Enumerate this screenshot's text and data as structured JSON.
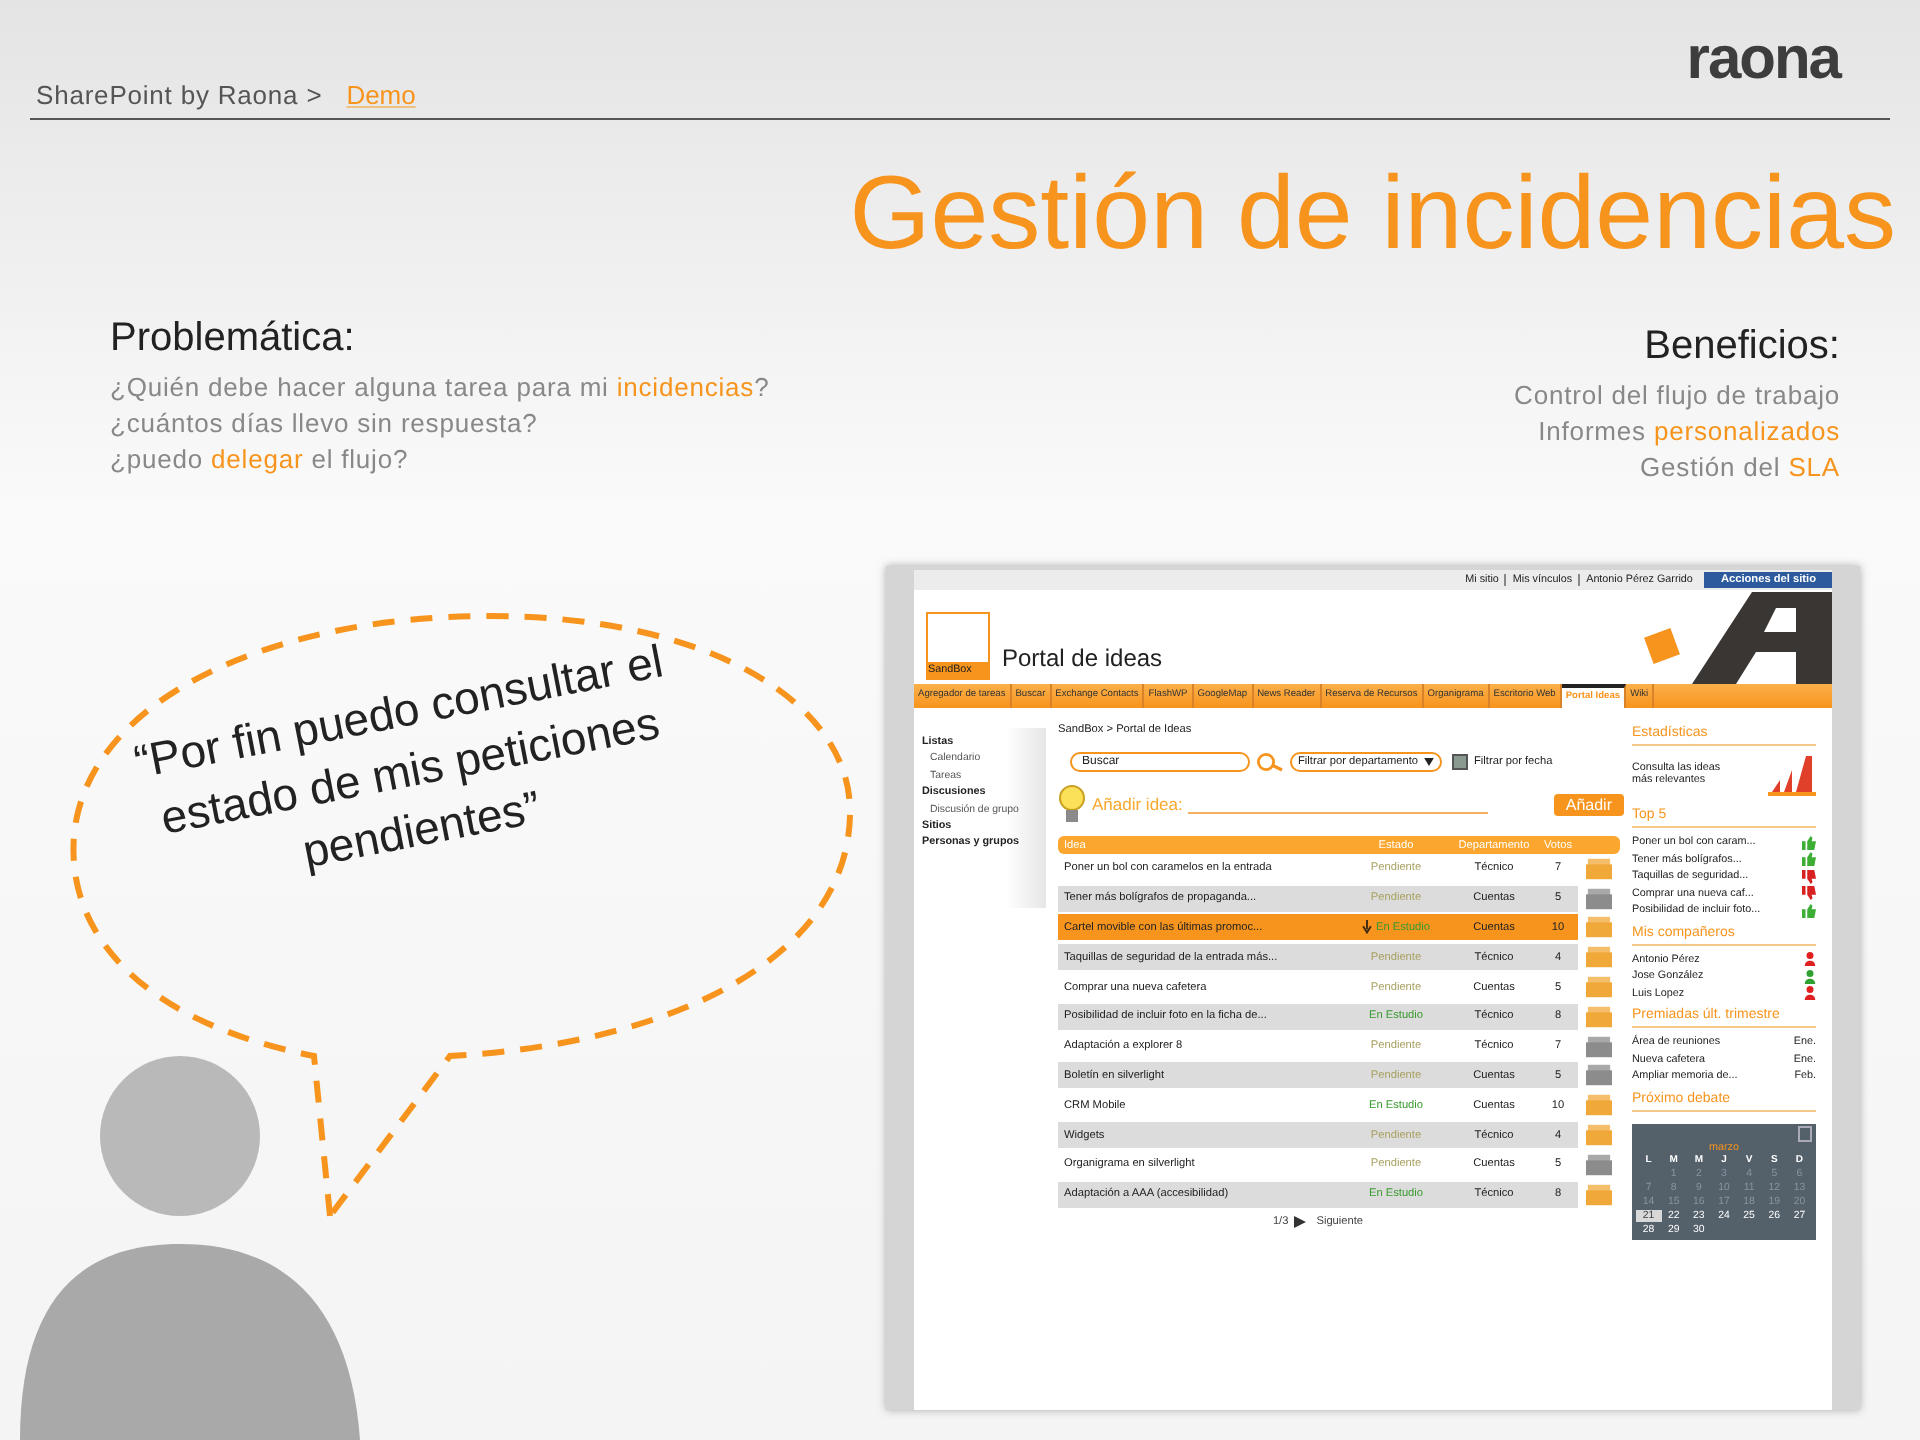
{
  "header": {
    "breadcrumb": "SharePoint by Raona >",
    "current": "Demo",
    "logo": "raona"
  },
  "title": "Gestión de incidencias",
  "problems": {
    "heading": "Problemática:",
    "lines": [
      [
        {
          "text": "¿Quién debe hacer alguna tarea para mi ",
          "highlight": false
        },
        {
          "text": "incidencias",
          "highlight": true
        },
        {
          "text": "?",
          "highlight": false
        }
      ],
      [
        {
          "text": "¿cuántos días llevo sin respuesta?",
          "highlight": false
        }
      ],
      [
        {
          "text": "¿puedo ",
          "highlight": false
        },
        {
          "text": "delegar",
          "highlight": true
        },
        {
          "text": " el flujo?",
          "highlight": false
        }
      ]
    ]
  },
  "benefits": {
    "heading": "Beneficios:",
    "lines": [
      [
        {
          "text": "Control del flujo de trabajo",
          "highlight": false
        }
      ],
      [
        {
          "text": "Informes ",
          "highlight": false
        },
        {
          "text": "personalizados",
          "highlight": true
        }
      ],
      [
        {
          "text": "Gestión del ",
          "highlight": false
        },
        {
          "text": "SLA",
          "highlight": true
        }
      ]
    ]
  },
  "quote": "“Por fin puedo consultar el estado de mis peticiones pendientes”",
  "sharepoint": {
    "top_links": [
      "Mi sitio",
      "Mis vínculos",
      "Antonio Pérez Garrido"
    ],
    "actions": "Acciones del sitio",
    "logo_label": "SandBox",
    "site_title": "Portal de ideas",
    "tabs": [
      {
        "label": "Agregador de tareas",
        "selected": false
      },
      {
        "label": "Buscar",
        "selected": false
      },
      {
        "label": "Exchange Contacts",
        "selected": false
      },
      {
        "label": "FlashWP",
        "selected": false
      },
      {
        "label": "GoogleMap",
        "selected": false
      },
      {
        "label": "News Reader",
        "selected": false
      },
      {
        "label": "Reserva de Recursos",
        "selected": false
      },
      {
        "label": "Organigrama",
        "selected": false
      },
      {
        "label": "Escritorio Web",
        "selected": false
      },
      {
        "label": "Portal Ideas",
        "selected": true
      },
      {
        "label": "Wiki",
        "selected": false
      }
    ],
    "quick_launch": [
      {
        "label": "Listas",
        "children": [
          {
            "label": "Calendario"
          },
          {
            "label": "Tareas"
          }
        ]
      },
      {
        "label": "Discusiones",
        "children": [
          {
            "label": "Discusión de grupo"
          }
        ]
      },
      {
        "label": "Sitios"
      },
      {
        "label": "Personas y grupos"
      }
    ],
    "breadcrumb": "SandBox > Portal de Ideas",
    "search": {
      "placeholder": "Buscar"
    },
    "department_filter": "Filtrar por departamento",
    "date_filter": {
      "label": "Filtrar por fecha",
      "checked": false
    },
    "add_idea": {
      "label": "Añadir idea:",
      "button": "Añadir"
    },
    "table": {
      "columns": [
        "Idea",
        "Estado",
        "Departamento",
        "Votos"
      ],
      "rows": [
        {
          "idea": "Poner un bol con caramelos en la entrada",
          "status": {
            "text": "Pendiente",
            "color": "#a8a060"
          },
          "department": "Técnico",
          "votes": "7",
          "selected": false,
          "box": {
            "color": "#f0a838"
          }
        },
        {
          "idea": "Tener más bolígrafos de propaganda...",
          "status": {
            "text": "Pendiente",
            "color": "#a8a060"
          },
          "department": "Cuentas",
          "votes": "5",
          "selected": false,
          "box": {
            "color": "#8c8c8c"
          }
        },
        {
          "idea": "Cartel movible con las últimas promoc...",
          "status": {
            "text": "En Estudio",
            "color": "#3a9a30"
          },
          "department": "Cuentas",
          "votes": "10",
          "selected": true,
          "box": {
            "color": "#f0a838"
          }
        },
        {
          "idea": "Taquillas de seguridad de la entrada más...",
          "status": {
            "text": "Pendiente",
            "color": "#a8a060"
          },
          "department": "Técnico",
          "votes": "4",
          "selected": false,
          "box": {
            "color": "#f0a838"
          }
        },
        {
          "idea": "Comprar una nueva cafetera",
          "status": {
            "text": "Pendiente",
            "color": "#a8a060"
          },
          "department": "Cuentas",
          "votes": "5",
          "selected": false,
          "box": {
            "color": "#f0a838"
          }
        },
        {
          "idea": "Posibilidad de incluir foto en la ficha de...",
          "status": {
            "text": "En Estudio",
            "color": "#3a9a30"
          },
          "department": "Técnico",
          "votes": "8",
          "selected": false,
          "box": {
            "color": "#f0a838"
          }
        },
        {
          "idea": "Adaptación a explorer 8",
          "status": {
            "text": "Pendiente",
            "color": "#a8a060"
          },
          "department": "Técnico",
          "votes": "7",
          "selected": false,
          "box": {
            "color": "#8c8c8c"
          }
        },
        {
          "idea": "Boletín en silverlight",
          "status": {
            "text": "Pendiente",
            "color": "#a8a060"
          },
          "department": "Cuentas",
          "votes": "5",
          "selected": false,
          "box": {
            "color": "#8c8c8c"
          }
        },
        {
          "idea": "CRM Mobile",
          "status": {
            "text": "En Estudio",
            "color": "#3a9a30"
          },
          "department": "Cuentas",
          "votes": "10",
          "selected": false,
          "box": {
            "color": "#f0a838"
          }
        },
        {
          "idea": "Widgets",
          "status": {
            "text": "Pendiente",
            "color": "#a8a060"
          },
          "department": "Técnico",
          "votes": "4",
          "selected": false,
          "box": {
            "color": "#f0a838"
          }
        },
        {
          "idea": "Organigrama en silverlight",
          "status": {
            "text": "Pendiente",
            "color": "#a8a060"
          },
          "department": "Cuentas",
          "votes": "5",
          "selected": false,
          "box": {
            "color": "#8c8c8c"
          }
        },
        {
          "idea": "Adaptación a AAA (accesibilidad)",
          "status": {
            "text": "En Estudio",
            "color": "#3a9a30"
          },
          "department": "Técnico",
          "votes": "8",
          "selected": false,
          "box": {
            "color": "#f0a838"
          }
        }
      ]
    },
    "pager": {
      "page": "1/3",
      "next": "Siguiente"
    },
    "sidebar": {
      "statistics": {
        "heading": "Estadísticas",
        "text": "Consulta las ideas más relevantes"
      },
      "top5": {
        "heading": "Top 5",
        "items": [
          {
            "label": "Poner un bol con caram...",
            "kind": "up"
          },
          {
            "label": "Tener más bolígrafos...",
            "kind": "up"
          },
          {
            "label": "Taquillas de seguridad...",
            "kind": "down"
          },
          {
            "label": "Comprar una nueva caf...",
            "kind": "down"
          },
          {
            "label": "Posibilidad de incluir foto...",
            "kind": "up"
          }
        ]
      },
      "colleagues": {
        "heading": "Mis compañeros",
        "items": [
          {
            "name": "Antonio Pérez",
            "color": "#e02020"
          },
          {
            "name": "Jose González",
            "color": "#30a030"
          },
          {
            "name": "Luis Lopez",
            "color": "#e02020"
          }
        ]
      },
      "awarded": {
        "heading": "Premiadas últ. trimestre",
        "items": [
          {
            "label": "Área de reuniones",
            "month": "Ene."
          },
          {
            "label": "Nueva cafetera",
            "month": "Ene."
          },
          {
            "label": "Ampliar memoria de...",
            "month": "Feb."
          }
        ]
      },
      "debate": {
        "heading": "Próximo debate",
        "calendar": {
          "month": "marzo",
          "weekdays": [
            "L",
            "M",
            "M",
            "J",
            "V",
            "S",
            "D"
          ],
          "weeks": [
            [
              {
                "kind": "blank"
              },
              {
                "kind": "day",
                "day": "1",
                "past": true,
                "selected": false
              },
              {
                "kind": "day",
                "day": "2",
                "past": true,
                "selected": false
              },
              {
                "kind": "day",
                "day": "3",
                "past": true,
                "selected": false
              },
              {
                "kind": "day",
                "day": "4",
                "past": true,
                "selected": false
              },
              {
                "kind": "day",
                "day": "5",
                "past": true,
                "selected": false
              },
              {
                "kind": "day",
                "day": "6",
                "past": true,
                "selected": false
              }
            ],
            [
              {
                "kind": "day",
                "day": "7",
                "past": true,
                "selected": false
              },
              {
                "kind": "day",
                "day": "8",
                "past": true,
                "selected": false
              },
              {
                "kind": "day",
                "day": "9",
                "past": true,
                "selected": false
              },
              {
                "kind": "day",
                "day": "10",
                "past": true,
                "selected": false
              },
              {
                "kind": "day",
                "day": "11",
                "past": true,
                "selected": false
              },
              {
                "kind": "day",
                "day": "12",
                "past": true,
                "selected": false
              },
              {
                "kind": "day",
                "day": "13",
                "past": true,
                "selected": false
              }
            ],
            [
              {
                "kind": "day",
                "day": "14",
                "past": true,
                "selected": false
              },
              {
                "kind": "day",
                "day": "15",
                "past": true,
                "selected": false
              },
              {
                "kind": "day",
                "day": "16",
                "past": true,
                "selected": false
              },
              {
                "kind": "day",
                "day": "17",
                "past": true,
                "selected": false
              },
              {
                "kind": "day",
                "day": "18",
                "past": true,
                "selected": false
              },
              {
                "kind": "day",
                "day": "19",
                "past": true,
                "selected": false
              },
              {
                "kind": "day",
                "day": "20",
                "past": true,
                "selected": false
              }
            ],
            [
              {
                "kind": "day",
                "day": "21",
                "past": false,
                "selected": true
              },
              {
                "kind": "day",
                "day": "22",
                "past": false,
                "selected": false
              },
              {
                "kind": "day",
                "day": "23",
                "past": false,
                "selected": false
              },
              {
                "kind": "day",
                "day": "24",
                "past": false,
                "selected": false
              },
              {
                "kind": "day",
                "day": "25",
                "past": false,
                "selected": false
              },
              {
                "kind": "day",
                "day": "26",
                "past": false,
                "selected": false
              },
              {
                "kind": "day",
                "day": "27",
                "past": false,
                "selected": false
              }
            ],
            [
              {
                "kind": "day",
                "day": "28",
                "past": false,
                "selected": false
              },
              {
                "kind": "day",
                "day": "29",
                "past": false,
                "selected": false
              },
              {
                "kind": "day",
                "day": "30",
                "past": false,
                "selected": false
              }
            ]
          ]
        }
      }
    }
  }
}
